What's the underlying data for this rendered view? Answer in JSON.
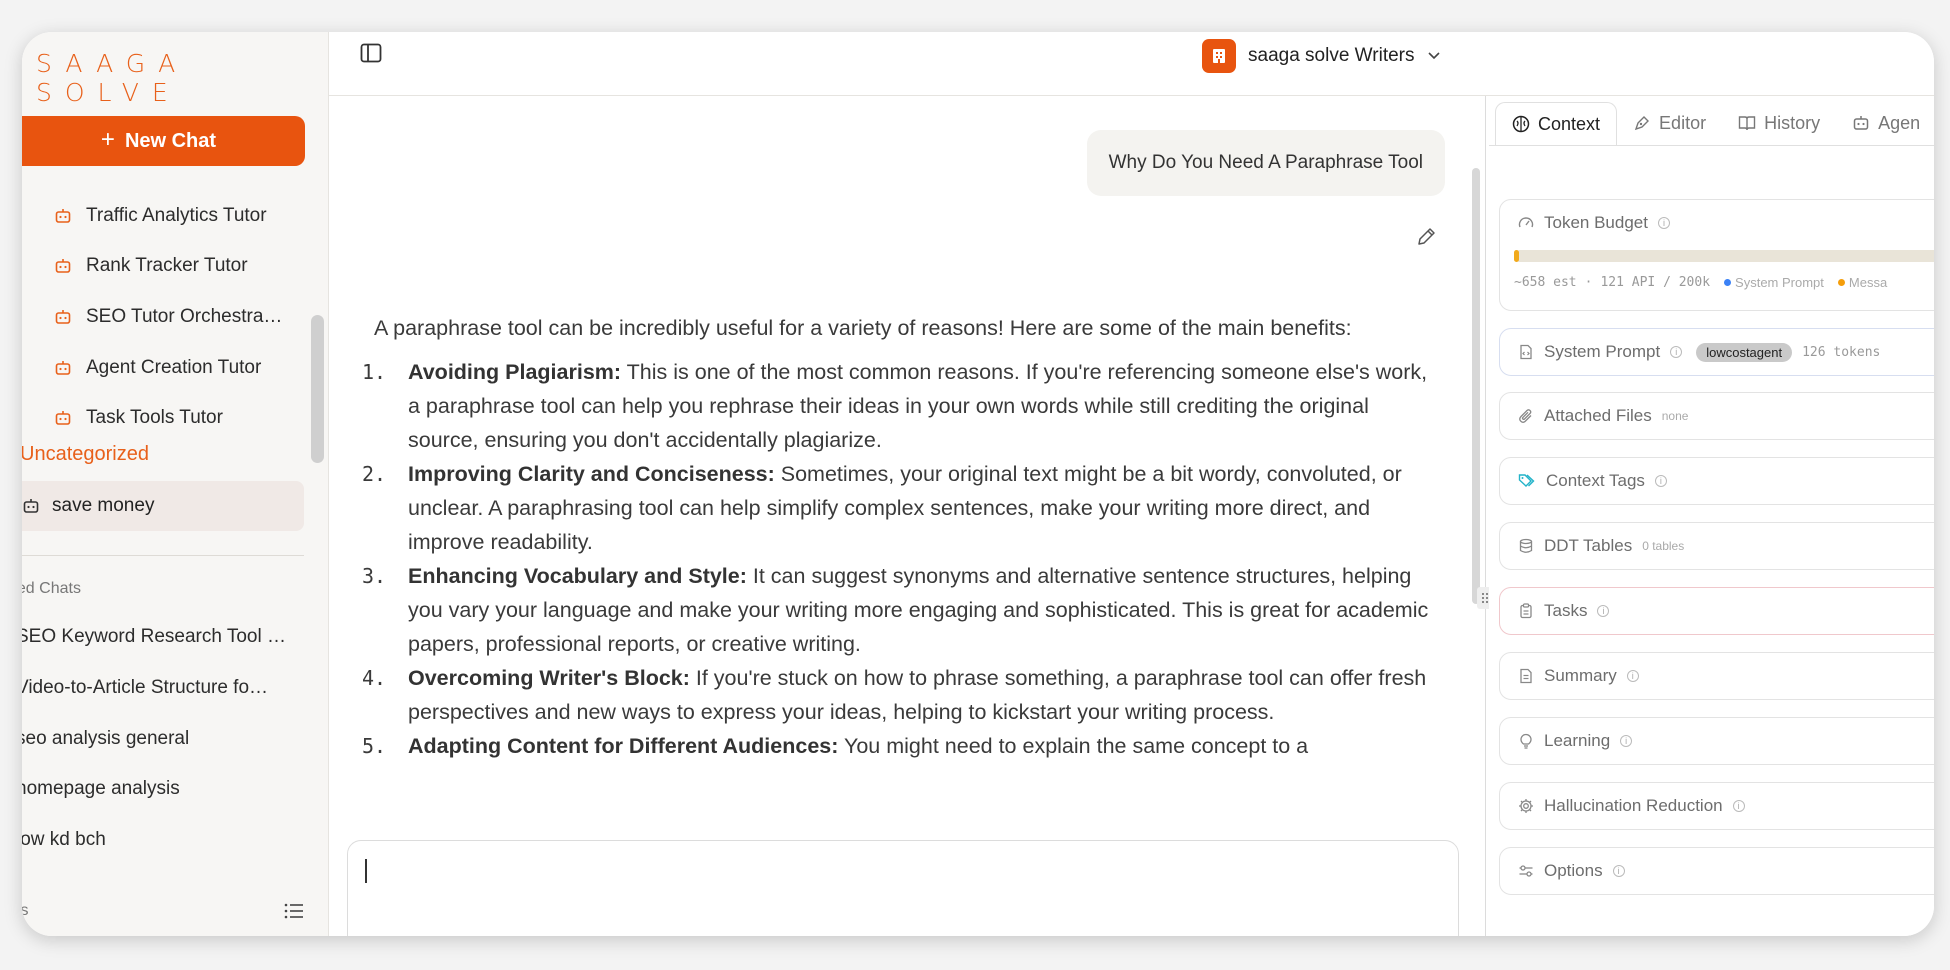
{
  "brand": {
    "logo_text": "SAAGA SOLVE",
    "accent": "#e8540f"
  },
  "sidebar": {
    "new_chat_label": "New Chat",
    "tutors": [
      "Traffic Analytics Tutor",
      "Rank Tracker Tutor",
      "SEO Tutor Orchestra…",
      "Agent Creation Tutor",
      "Task Tools Tutor"
    ],
    "category_label": "Uncategorized",
    "selected_agent": "save money",
    "section_label": "ned Chats",
    "chats": [
      "SEO Keyword Research Tool …",
      "Video-to-Article Structure fo…",
      "seo analysis general",
      "homepage analysis",
      "low kd bch"
    ],
    "bottom_label": "ts"
  },
  "header": {
    "workspace_name": "saaga solve Writers"
  },
  "chat": {
    "user_message": "Why Do You Need A Paraphrase Tool",
    "answer_intro": "A paraphrase tool can be incredibly useful for a variety of reasons! Here are some of the main benefits:",
    "points": [
      {
        "num": "1.",
        "title": "Avoiding Plagiarism:",
        "text": " This is one of the most common reasons. If you're referencing someone else's work, a paraphrase tool can help you rephrase their ideas in your own words while still crediting the original source, ensuring you don't accidentally plagiarize."
      },
      {
        "num": "2.",
        "title": "Improving Clarity and Conciseness:",
        "text": " Sometimes, your original text might be a bit wordy, convoluted, or unclear. A paraphrasing tool can help simplify complex sentences, make your writing more direct, and improve readability."
      },
      {
        "num": "3.",
        "title": "Enhancing Vocabulary and Style:",
        "text": " It can suggest synonyms and alternative sentence structures, helping you vary your language and make your writing more engaging and sophisticated. This is great for academic papers, professional reports, or creative writing."
      },
      {
        "num": "4.",
        "title": "Overcoming Writer's Block:",
        "text": " If you're stuck on how to phrase something, a paraphrase tool can offer fresh perspectives and new ways to express your ideas, helping to kickstart your writing process."
      },
      {
        "num": "5.",
        "title": "Adapting Content for Different Audiences:",
        "text": " You might need to explain the same concept to a"
      }
    ]
  },
  "panel": {
    "tabs": [
      "Context",
      "Editor",
      "History",
      "Agen"
    ],
    "token_budget": {
      "label": "Token Budget",
      "fill_fraction": 0.01,
      "est": "~658 est",
      "sep": "·",
      "api": "121 API / 200k",
      "legend": [
        {
          "label": "System Prompt",
          "color": "#3b82f6"
        },
        {
          "label": "Messa",
          "color": "#f59e0b"
        }
      ]
    },
    "system_prompt": {
      "label": "System Prompt",
      "chip": "lowcostagent",
      "tokens": "126 tokens"
    },
    "attached_files": {
      "label": "Attached Files",
      "value": "none"
    },
    "context_tags": {
      "label": "Context Tags"
    },
    "ddt_tables": {
      "label": "DDT Tables",
      "value": "0 tables"
    },
    "tasks": {
      "label": "Tasks",
      "border": "#f0c8cc"
    },
    "summary": {
      "label": "Summary"
    },
    "learning": {
      "label": "Learning"
    },
    "hallucination": {
      "label": "Hallucination Reduction"
    },
    "options": {
      "label": "Options"
    }
  }
}
